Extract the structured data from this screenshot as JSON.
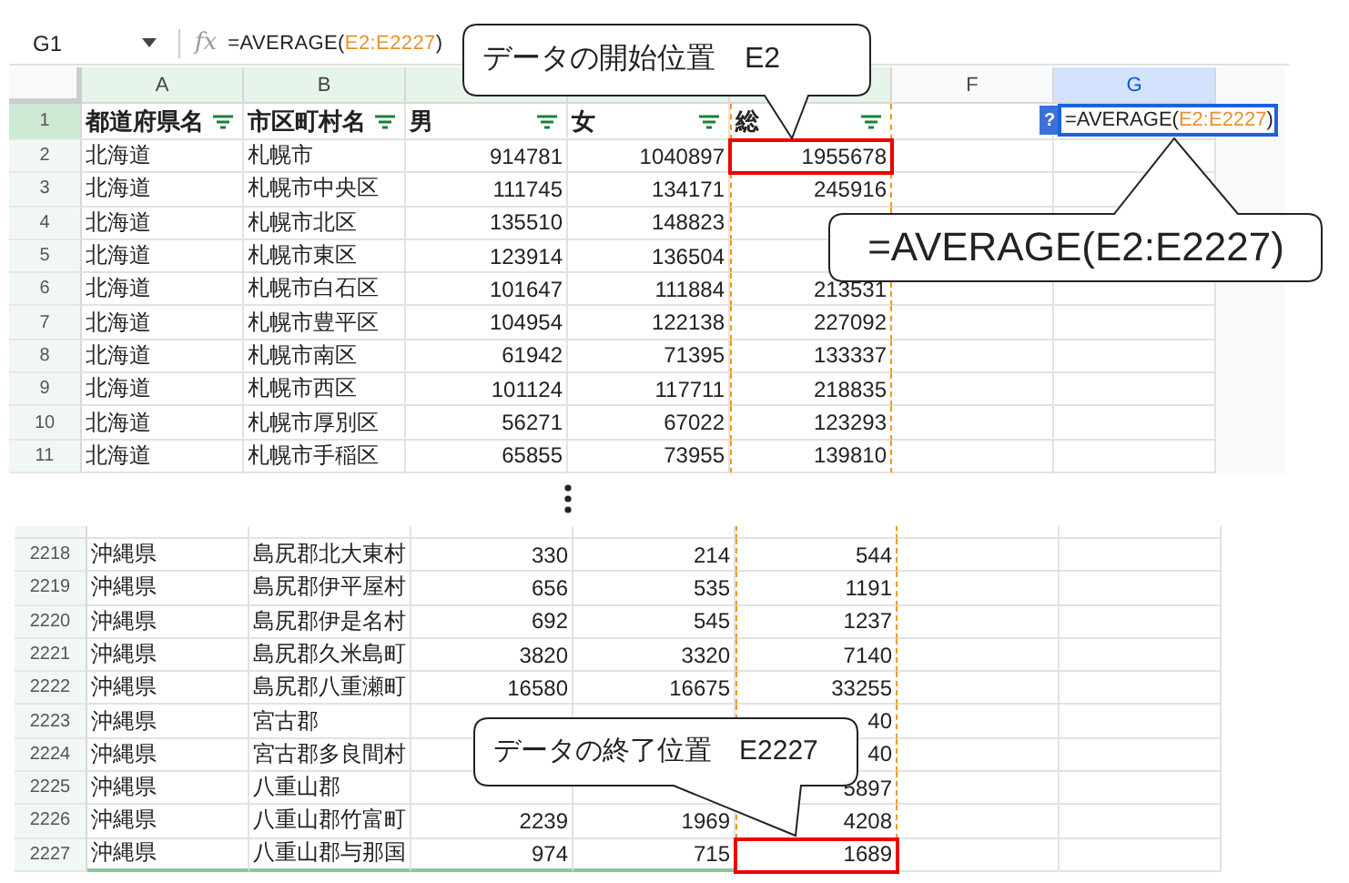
{
  "formula_bar": {
    "cell_ref": "G1",
    "function_label": "fx",
    "formula": {
      "prefix": "=AVERAGE(",
      "ref": "E2:E2227",
      "suffix": ")"
    }
  },
  "columns": [
    {
      "letter": "A",
      "selected": false,
      "in_range": false
    },
    {
      "letter": "B",
      "selected": false,
      "in_range": false
    },
    {
      "selected": false,
      "in_range": false
    },
    {
      "selected": false,
      "in_range": false
    },
    {
      "selected": false,
      "in_range": true
    },
    {
      "letter": "F",
      "selected": false,
      "in_range": false
    },
    {
      "letter": "G",
      "selected": true,
      "in_range": false
    }
  ],
  "header_row": {
    "number": "1",
    "selected": true,
    "cells": [
      {
        "text": "都道府県名",
        "filter": true
      },
      {
        "text": "市区町村名",
        "filter": true
      },
      {
        "text": "男",
        "filter": true
      },
      {
        "text": "女",
        "filter": true
      },
      {
        "text": "総",
        "filter": true
      }
    ],
    "cell_editor": {
      "help_badge": "?",
      "formula": {
        "prefix": "=AVERAGE(",
        "ref": "E2:E2227",
        "suffix": ")"
      }
    }
  },
  "top_rows": [
    {
      "number": "2",
      "cells": [
        "北海道",
        "札幌市",
        "914781",
        "1040897",
        "1955678"
      ],
      "marked": true
    },
    {
      "number": "3",
      "cells": [
        "北海道",
        "札幌市中央区",
        "111745",
        "134171",
        "245916"
      ],
      "marked": false
    },
    {
      "number": "4",
      "cells": [
        "北海道",
        "札幌市北区",
        "135510",
        "148823",
        null
      ],
      "marked": false
    },
    {
      "number": "5",
      "cells": [
        "北海道",
        "札幌市東区",
        "123914",
        "136504",
        null
      ],
      "marked": false
    },
    {
      "number": "6",
      "cells": [
        "北海道",
        "札幌市白石区",
        "101647",
        "111884",
        "213531"
      ],
      "marked": false
    },
    {
      "number": "7",
      "cells": [
        "北海道",
        "札幌市豊平区",
        "104954",
        "122138",
        "227092"
      ],
      "marked": false
    },
    {
      "number": "8",
      "cells": [
        "北海道",
        "札幌市南区",
        "61942",
        "71395",
        "133337"
      ],
      "marked": false
    },
    {
      "number": "9",
      "cells": [
        "北海道",
        "札幌市西区",
        "101124",
        "117711",
        "218835"
      ],
      "marked": false
    },
    {
      "number": "10",
      "cells": [
        "北海道",
        "札幌市厚別区",
        "56271",
        "67022",
        "123293"
      ],
      "marked": false
    },
    {
      "number": "11",
      "cells": [
        "北海道",
        "札幌市手稲区",
        "65855",
        "73955",
        "139810"
      ],
      "marked": false
    }
  ],
  "bottom_rows": [
    {
      "number": "2218",
      "cells": [
        "沖縄県",
        "島尻郡北大東村",
        "330",
        "214",
        "544"
      ],
      "marked": false
    },
    {
      "number": "2219",
      "cells": [
        "沖縄県",
        "島尻郡伊平屋村",
        "656",
        "535",
        "1191"
      ],
      "marked": false
    },
    {
      "number": "2220",
      "cells": [
        "沖縄県",
        "島尻郡伊是名村",
        "692",
        "545",
        "1237"
      ],
      "marked": false
    },
    {
      "number": "2221",
      "cells": [
        "沖縄県",
        "島尻郡久米島町",
        "3820",
        "3320",
        "7140"
      ],
      "marked": false
    },
    {
      "number": "2222",
      "cells": [
        "沖縄県",
        "島尻郡八重瀬町",
        "16580",
        "16675",
        "33255"
      ],
      "marked": false
    },
    {
      "number": "2223",
      "cells": [
        "沖縄県",
        "宮古郡",
        null,
        null,
        "40"
      ],
      "marked": false
    },
    {
      "number": "2224",
      "cells": [
        "沖縄県",
        "宮古郡多良間村",
        null,
        null,
        "40"
      ],
      "marked": false
    },
    {
      "number": "2225",
      "cells": [
        "沖縄県",
        "八重山郡",
        null,
        null,
        "5897"
      ],
      "marked": false
    },
    {
      "number": "2226",
      "cells": [
        "沖縄県",
        "八重山郡竹富町",
        "2239",
        "1969",
        "4208"
      ],
      "marked": false
    },
    {
      "number": "2227",
      "cells": [
        "沖縄県",
        "八重山郡与那国",
        "974",
        "715",
        "1689"
      ],
      "marked": true
    }
  ],
  "callouts": [
    {
      "text": "データの開始位置　E2"
    },
    {
      "text": "=AVERAGE(E2:E2227)"
    },
    {
      "text": "データの終了位置　E2227"
    }
  ]
}
